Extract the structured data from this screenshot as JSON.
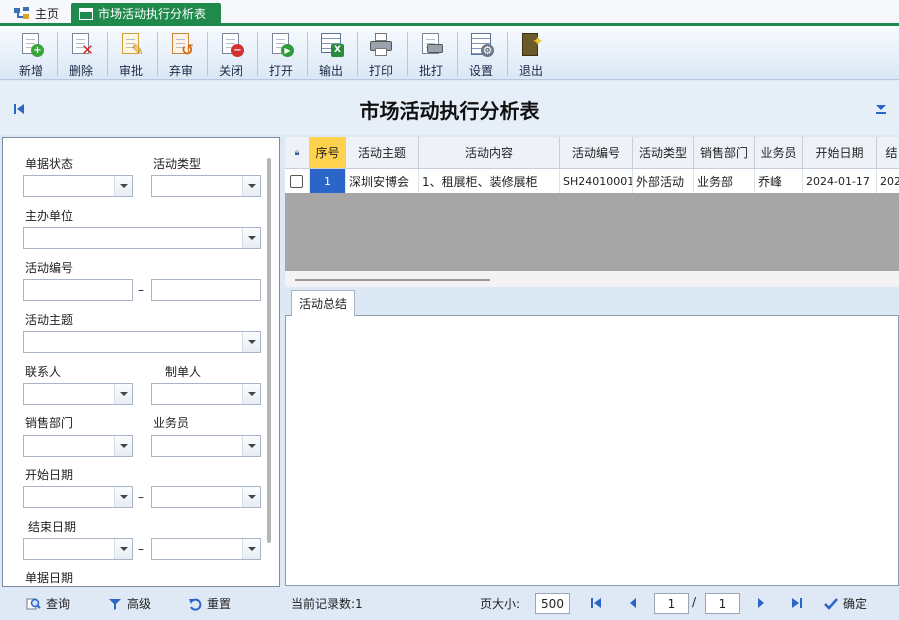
{
  "tabs": {
    "home": "主页",
    "active": "市场活动执行分析表"
  },
  "toolbar": [
    {
      "label": "新增",
      "icon": "add-icon"
    },
    {
      "label": "删除",
      "icon": "delete-icon"
    },
    {
      "label": "审批",
      "icon": "approve-icon"
    },
    {
      "label": "弃审",
      "icon": "unapprove-icon"
    },
    {
      "label": "关闭",
      "icon": "close-icon"
    },
    {
      "label": "打开",
      "icon": "open-icon"
    },
    {
      "label": "输出",
      "icon": "export-icon"
    },
    {
      "label": "打印",
      "icon": "print-icon"
    },
    {
      "label": "批打",
      "icon": "batch-print-icon"
    },
    {
      "label": "设置",
      "icon": "settings-icon"
    },
    {
      "label": "退出",
      "icon": "exit-icon"
    }
  ],
  "page_title": "市场活动执行分析表",
  "filters": {
    "status": "单据状态",
    "type": "活动类型",
    "host": "主办单位",
    "code": "活动编号",
    "subject": "活动主题",
    "contact": "联系人",
    "creator": "制单人",
    "dept": "销售部门",
    "salesman": "业务员",
    "start_date": "开始日期",
    "end_date": "结束日期",
    "bill_date": "单据日期",
    "range_sep": "–"
  },
  "grid": {
    "columns": [
      "序号",
      "活动主题",
      "活动内容",
      "活动编号",
      "活动类型",
      "销售部门",
      "业务员",
      "开始日期",
      "结"
    ],
    "rows": [
      {
        "seq": "1",
        "subject": "深圳安博会",
        "content": "1、租展柜、装修展柜",
        "code": "SH24010001",
        "type": "外部活动",
        "dept": "业务部",
        "salesman": "乔峰",
        "start": "2024-01-17",
        "end": "202"
      }
    ]
  },
  "summary_tab": "活动总结",
  "statusbar": {
    "query": "查询",
    "advanced": "高级",
    "reset": "重置",
    "record_count": "当前记录数:1",
    "page_size_label": "页大小:",
    "page_size": "500",
    "current_page": "1",
    "page_sep": "/",
    "total_pages": "1",
    "confirm": "确定"
  },
  "colors": {
    "tab_active": "#1f8a4c",
    "selected_cell": "#2c65c8",
    "header_seq": "#ffd24d"
  }
}
